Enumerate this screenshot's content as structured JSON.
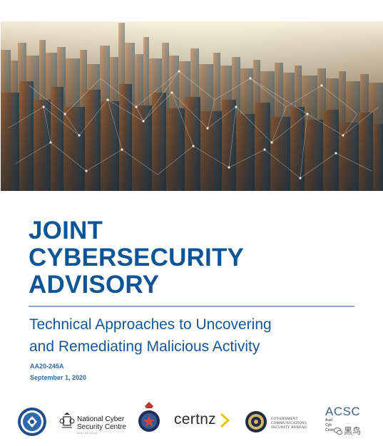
{
  "document": {
    "title_lines": [
      "JOINT",
      "CYBERSECURITY",
      "ADVISORY"
    ],
    "subtitle_lines": [
      "Technical Approaches to Uncovering",
      "and Remediating Malicious Activity"
    ],
    "advisory_id": "AA20-245A",
    "date": "September 1, 2020"
  },
  "logos": {
    "ncsc_lines": [
      "National Cyber",
      "Security Centre"
    ],
    "ncsc_sub": "PART OF GCHQ",
    "certnz": "certnz",
    "gcsb_lines": [
      "GOVERNMENT",
      "COMMUNICATIONS",
      "SECURITY BUREAU"
    ],
    "acsc": "ACSC",
    "acsc_sub_lines": [
      "Aust",
      "Cyb",
      "Centr"
    ]
  },
  "watermark": {
    "text": "黑鸟"
  },
  "colors": {
    "title_blue": "#0e5597",
    "subtitle_blue": "#15569a",
    "meta_blue": "#2f6aa8",
    "rule": "#8aa6c6",
    "certnz_accent": "#f3c300"
  }
}
